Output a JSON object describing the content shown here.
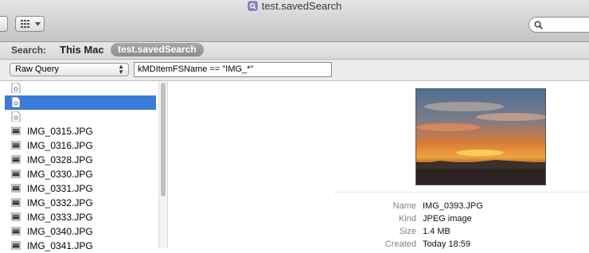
{
  "window": {
    "title": "test.savedSearch"
  },
  "toolbar": {
    "view_icon": "list-view-icon",
    "search_icon": "search-icon"
  },
  "scope": {
    "search_label": "Search:",
    "this_mac": "This Mac",
    "saved_search": "test.savedSearch"
  },
  "query": {
    "type": "Raw Query",
    "value": "kMDItemFSName == \"IMG_*\""
  },
  "list": {
    "items": [
      {
        "label": "",
        "icon": "document-icon"
      },
      {
        "label": "",
        "icon": "document-icon",
        "selected": true
      },
      {
        "label": "",
        "icon": "document-icon"
      },
      {
        "label": "IMG_0315.JPG",
        "icon": "image-thumbnail-icon"
      },
      {
        "label": "IMG_0316.JPG",
        "icon": "image-thumbnail-icon"
      },
      {
        "label": "IMG_0328.JPG",
        "icon": "image-thumbnail-icon"
      },
      {
        "label": "IMG_0330.JPG",
        "icon": "image-thumbnail-icon"
      },
      {
        "label": "IMG_0331.JPG",
        "icon": "image-thumbnail-icon"
      },
      {
        "label": "IMG_0332.JPG",
        "icon": "image-thumbnail-icon"
      },
      {
        "label": "IMG_0333.JPG",
        "icon": "image-thumbnail-icon"
      },
      {
        "label": "IMG_0340.JPG",
        "icon": "image-thumbnail-icon"
      },
      {
        "label": "IMG_0341.JPG",
        "icon": "image-thumbnail-icon"
      }
    ]
  },
  "preview": {
    "meta": [
      {
        "key": "Name",
        "value": "IMG_0393.JPG"
      },
      {
        "key": "Kind",
        "value": "JPEG image"
      },
      {
        "key": "Size",
        "value": "1.4 MB"
      },
      {
        "key": "Created",
        "value": "Today 18:59"
      }
    ]
  },
  "colors": {
    "selection": "#3b7bd8",
    "toolbar_top": "#e4e4e4",
    "toolbar_bottom": "#c4c4c4"
  }
}
